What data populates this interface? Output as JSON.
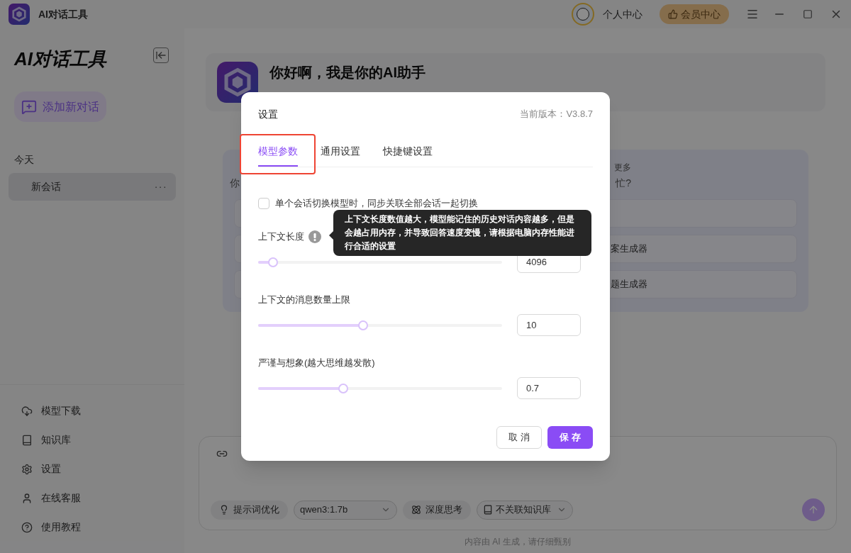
{
  "title_bar": {
    "app_name": "AI对话工具",
    "user_link": "个人中心",
    "vip_button": "会员中心"
  },
  "sidebar": {
    "title": "AI对话工具",
    "new_chat_button": "添加新对话",
    "group_label": "今天",
    "sessions": [
      {
        "title": "新会话",
        "more": "···",
        "selected": true
      }
    ],
    "menu": [
      {
        "label": "模型下载"
      },
      {
        "label": "知识库"
      },
      {
        "label": "设置"
      },
      {
        "label": "在线客服"
      },
      {
        "label": "使用教程"
      }
    ]
  },
  "welcome": {
    "title": "你好啊，我是你的AI助手"
  },
  "suggestions": {
    "left_fragment": "你",
    "header_fragment": "更多",
    "question_fragment": "忙?",
    "cards": [
      {
        "kind": "empty"
      },
      {
        "kind": "text",
        "text": "案生成器"
      },
      {
        "kind": "text",
        "text": "题生成器"
      }
    ]
  },
  "composer": {
    "chips": [
      {
        "kind": "toggle",
        "label": "提示词优化"
      },
      {
        "kind": "select",
        "label": "qwen3:1.7b"
      },
      {
        "kind": "toggle",
        "label": "深度思考"
      },
      {
        "kind": "select",
        "label": "不关联知识库"
      }
    ],
    "footer": "内容由 AI 生成，请仔细甄别"
  },
  "dialog": {
    "title": "设置",
    "version": "当前版本：V3.8.7",
    "tabs": [
      {
        "label": "模型参数",
        "selected": true,
        "highlighted": true
      },
      {
        "label": "通用设置",
        "selected": false,
        "highlighted": false
      },
      {
        "label": "快捷键设置",
        "selected": false,
        "highlighted": false
      }
    ],
    "sync_checkbox": {
      "label": "单个会话切换模型时，同步关联全部会话一起切换",
      "checked": false
    },
    "params": [
      {
        "label": "上下文长度",
        "info": true,
        "level": 0.06,
        "value": "4096"
      },
      {
        "label": "上下文的消息数量上限",
        "info": false,
        "level": 0.43,
        "value": "10"
      },
      {
        "label": "严谨与想象(越大思维越发散)",
        "info": false,
        "level": 0.35,
        "value": "0.7"
      }
    ],
    "tooltip": "上下文长度数值越大，模型能记住的历史对话内容越多，但是会越占用内存，并导致回答速度变慢，请根据电脑内存性能进行合适的设置",
    "cancel_button": "取 消",
    "save_button": "保 存"
  }
}
